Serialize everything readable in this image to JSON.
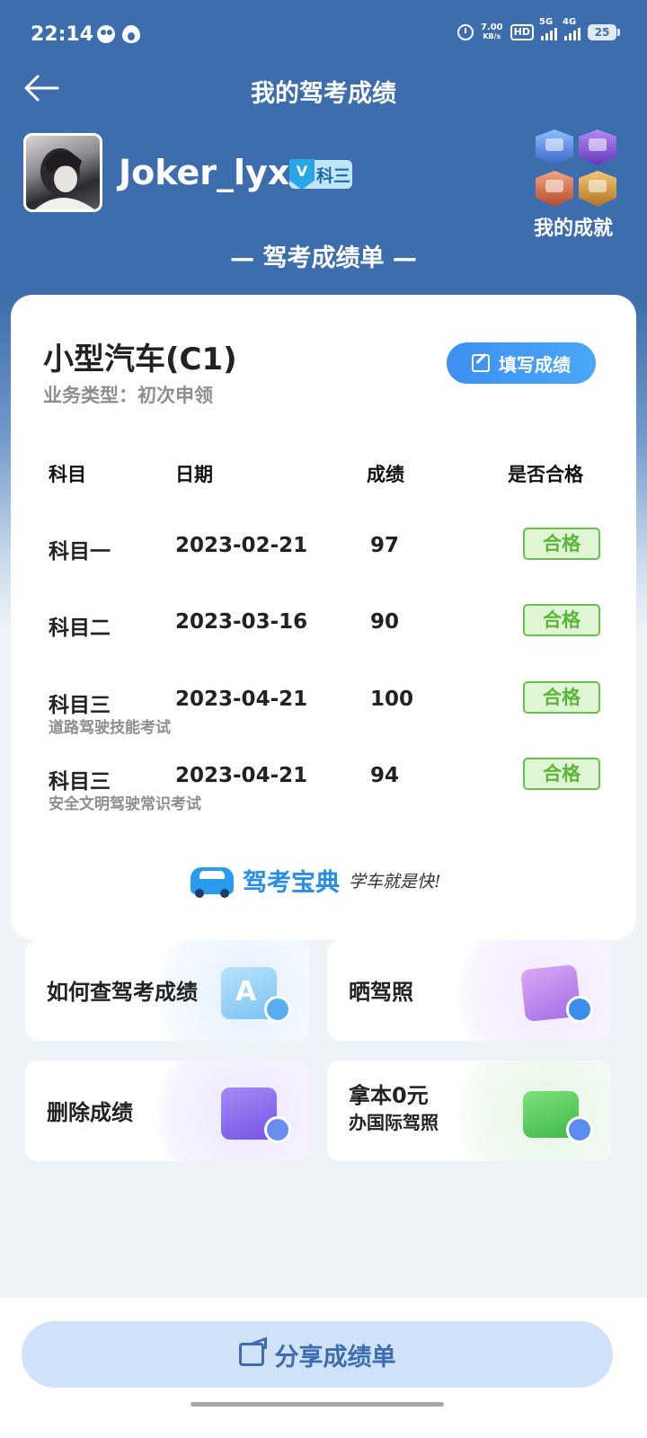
{
  "status_bar": {
    "time": "22:14",
    "net_speed_value": "7.00",
    "net_speed_unit": "KB/s",
    "hd_label": "HD",
    "signal1_label": "5G",
    "signal2_label": "4G",
    "battery": "25"
  },
  "header": {
    "title": "我的驾考成绩",
    "back_icon": "arrow-left-icon"
  },
  "profile": {
    "username": "Joker_lyx",
    "level_badge_v": "V",
    "level_badge": "科三",
    "achievements_label": "我的成就"
  },
  "section_title": "— 驾考成绩单 —",
  "card": {
    "vehicle": "小型汽车(C1)",
    "business_type": "业务类型：初次申领",
    "fill_button": "填写成绩",
    "table": {
      "headers": [
        "科目",
        "日期",
        "成绩",
        "是否合格"
      ],
      "rows": [
        {
          "subject": "科目一",
          "subtitle": "",
          "date": "2023-02-21",
          "score": "97",
          "status": "合格"
        },
        {
          "subject": "科目二",
          "subtitle": "",
          "date": "2023-03-16",
          "score": "90",
          "status": "合格"
        },
        {
          "subject": "科目三",
          "subtitle": "道路驾驶技能考试",
          "date": "2023-04-21",
          "score": "100",
          "status": "合格"
        },
        {
          "subject": "科目三",
          "subtitle": "安全文明驾驶常识考试",
          "date": "2023-04-21",
          "score": "94",
          "status": "合格"
        }
      ]
    },
    "brand_name": "驾考宝典",
    "brand_slogan": "学车就是快!"
  },
  "tiles": [
    {
      "label": "如何查驾考成绩",
      "icon": "search-document-icon"
    },
    {
      "label": "晒驾照",
      "icon": "photo-camera-icon"
    },
    {
      "label": "删除成绩",
      "icon": "delete-document-icon"
    },
    {
      "label_line1": "拿本0元",
      "label_line2": "办国际驾照",
      "icon": "license-globe-icon"
    }
  ],
  "share_button": "分享成绩单",
  "colors": {
    "header_blue": "#3d6dac",
    "accent_blue": "#3d8ff2",
    "pass_green": "#5ab63a"
  }
}
